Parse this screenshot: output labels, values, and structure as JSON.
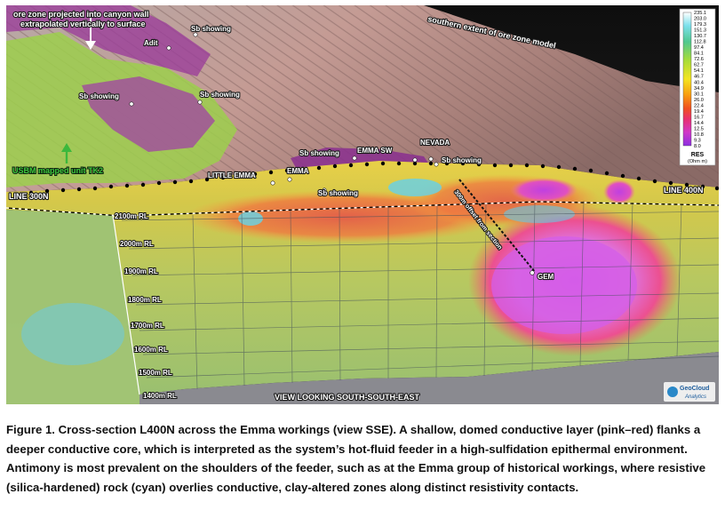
{
  "figure": {
    "labels": {
      "ore_zone_line1": "ore zone projected into canyon wall",
      "ore_zone_line2": "extrapolated vertically to surface",
      "southern_extent": "southern extent of ore zone model",
      "adit": "Adit",
      "sb_showing_top": "Sb showing",
      "sb_showing_left": "Sb showing",
      "sb_showing_mid": "Sb showing",
      "sb_showing_a": "Sb showing",
      "sb_showing_b": "Sb showing",
      "sb_showing_c": "Sb showing",
      "emma_sw": "EMMA SW",
      "nevada": "NEVADA",
      "little_emma": "LITTLE EMMA",
      "emma": "EMMA",
      "usbm_unit": "USBM mapped unit TK2",
      "line_300n": "LINE 300N",
      "line_400n": "LINE 400N",
      "offset_note": "300m offset from section",
      "gem": "GEM",
      "view": "VIEW LOOKING SOUTH-SOUTH-EAST"
    },
    "elevation_labels": [
      "2100m RL",
      "2000m RL",
      "1900m RL",
      "1800m RL",
      "1700m RL",
      "1600m RL",
      "1500m RL",
      "1400m RL"
    ],
    "legend": {
      "title": "RES",
      "unit": "(Ohm m)",
      "values": [
        "235.1",
        "203.0",
        "179.3",
        "151.3",
        "130.7",
        "112.8",
        "97.4",
        "84.1",
        "72.6",
        "62.7",
        "54.1",
        "46.7",
        "40.4",
        "34.9",
        "30.1",
        "26.0",
        "22.4",
        "19.4",
        "16.7",
        "14.4",
        "12.5",
        "10.8",
        "9.3",
        "8.0"
      ],
      "colors": [
        "#ffffff",
        "#c8f4f4",
        "#8fe8ee",
        "#54d8e8",
        "#3cc8d4",
        "#4cc8a8",
        "#5cc878",
        "#7cd050",
        "#9cd83c",
        "#bce030",
        "#dce828",
        "#f4e820",
        "#f8d018",
        "#f8b010",
        "#f89010",
        "#f47018",
        "#f05020",
        "#ec3030",
        "#e83068",
        "#e034a0",
        "#d838c8",
        "#c438e0",
        "#a838e8",
        "#8c30e0"
      ]
    },
    "logo": {
      "line1": "GeoCloud",
      "line2": "Analytics"
    }
  },
  "caption": "Figure 1. Cross-section L400N across the Emma workings (view SSE). A shallow, domed conductive layer (pink–red) flanks a deeper conductive core, which is interpreted as the system’s hot-fluid feeder in a high-sulfidation epithermal environment. Antimony is most prevalent on the shoulders of the feeder, such as at the Emma group of historical workings, where resistive (silica-hardened) rock (cyan) overlies conductive, clay-altered zones along distinct resistivity contacts."
}
